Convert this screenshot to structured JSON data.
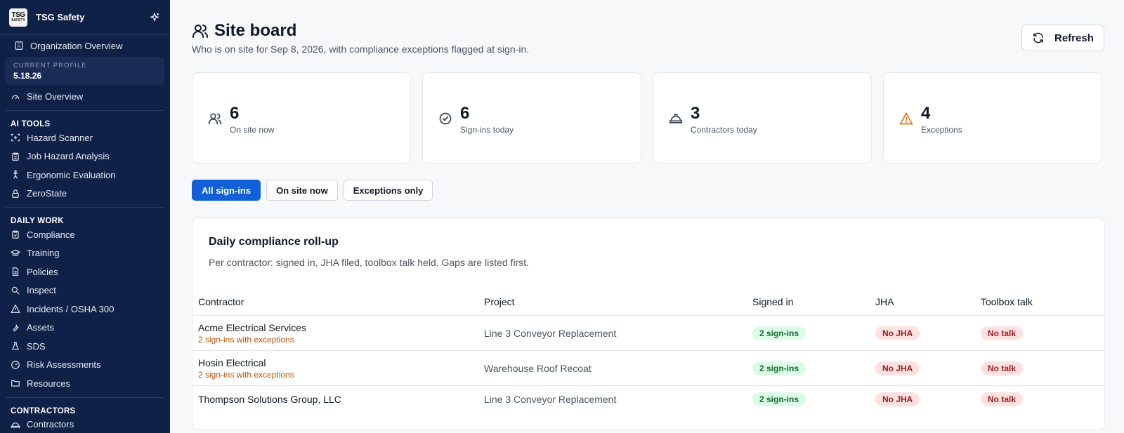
{
  "brand": {
    "logo_line1": "TSG",
    "logo_line2": "SAFETY",
    "name": "TSG Safety"
  },
  "sidebar": {
    "org_overview": "Organization Overview",
    "profile_label": "CURRENT PROFILE",
    "profile_value": "5.18.26",
    "site_overview": "Site Overview",
    "ai_tools_heading": "AI TOOLS",
    "ai_tools": [
      "Hazard Scanner",
      "Job Hazard Analysis",
      "Ergonomic Evaluation",
      "ZeroState"
    ],
    "daily_work_heading": "DAILY WORK",
    "daily_work": [
      "Compliance",
      "Training",
      "Policies",
      "Inspect",
      "Incidents / OSHA 300",
      "Assets",
      "SDS",
      "Risk Assessments",
      "Resources"
    ],
    "contractors_heading": "CONTRACTORS",
    "contractors": [
      "Contractors"
    ]
  },
  "header": {
    "title": "Site board",
    "subtitle": "Who is on site for Sep 8, 2026, with compliance exceptions flagged at sign-in.",
    "refresh_label": "Refresh"
  },
  "stats": [
    {
      "value": "6",
      "label": "On site now",
      "icon": "users-icon"
    },
    {
      "value": "6",
      "label": "Sign-ins today",
      "icon": "check-circle-icon"
    },
    {
      "value": "3",
      "label": "Contractors today",
      "icon": "hard-hat-icon"
    },
    {
      "value": "4",
      "label": "Exceptions",
      "icon": "warning-icon",
      "color": "#d97706"
    }
  ],
  "filters": [
    "All sign-ins",
    "On site now",
    "Exceptions only"
  ],
  "rollup": {
    "title": "Daily compliance roll-up",
    "description": "Per contractor: signed in, JHA filed, toolbox talk held. Gaps are listed first.",
    "columns": [
      "Contractor",
      "Project",
      "Signed in",
      "JHA",
      "Toolbox talk"
    ],
    "rows": [
      {
        "contractor": "Acme Electrical Services",
        "exceptions": "2 sign-ins with exceptions",
        "project": "Line 3 Conveyor Replacement",
        "signed_in": "2 sign-ins",
        "jha": "No JHA",
        "toolbox": "No talk"
      },
      {
        "contractor": "Hosin Electrical",
        "exceptions": "2 sign-ins with exceptions",
        "project": "Warehouse Roof Recoat",
        "signed_in": "2 sign-ins",
        "jha": "No JHA",
        "toolbox": "No talk"
      },
      {
        "contractor": "Thompson Solutions Group, LLC",
        "exceptions": "",
        "project": "Line 3 Conveyor Replacement",
        "signed_in": "2 sign-ins",
        "jha": "No JHA",
        "toolbox": "No talk"
      }
    ]
  },
  "colors": {
    "sidebar_bg": "#0f2147",
    "accent": "#1160d8",
    "warning": "#d97706",
    "ok_badge": "#dcfce7",
    "bad_badge": "#fee2e2"
  }
}
